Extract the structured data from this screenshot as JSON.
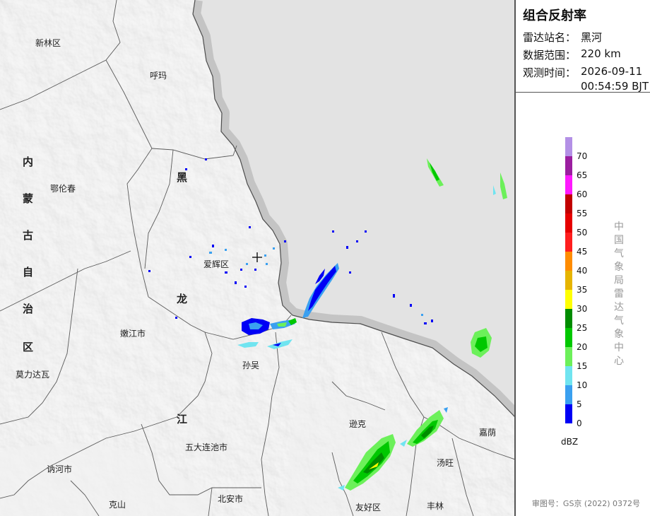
{
  "panel": {
    "title": "组合反射率",
    "station_label": "雷达站名：",
    "station_value": "黑河",
    "range_label": "数据范围：",
    "range_value": "220 km",
    "time_label": "观测时间：",
    "time_date": "2026-09-11",
    "time_clock": "00:54:59 BJT"
  },
  "legend": {
    "unit": "dBZ",
    "bins": [
      {
        "value": "70",
        "color": "#b390e6"
      },
      {
        "value": "65",
        "color": "#9b1ea0"
      },
      {
        "value": "60",
        "color": "#ff19ff"
      },
      {
        "value": "55",
        "color": "#c20000"
      },
      {
        "value": "50",
        "color": "#e60000"
      },
      {
        "value": "45",
        "color": "#ff1e1e"
      },
      {
        "value": "40",
        "color": "#ff8c00"
      },
      {
        "value": "35",
        "color": "#e6b400"
      },
      {
        "value": "30",
        "color": "#ffff00"
      },
      {
        "value": "25",
        "color": "#008c00"
      },
      {
        "value": "20",
        "color": "#00c800"
      },
      {
        "value": "15",
        "color": "#6cf05a"
      },
      {
        "value": "10",
        "color": "#70e4f0"
      },
      {
        "value": "5",
        "color": "#3aa0f0"
      },
      {
        "value": "0",
        "color": "#0000f5"
      }
    ]
  },
  "org_name": "中国气象局雷达气象中心",
  "copyright": "审图号：GS京 (2022) 0372号",
  "map": {
    "places": [
      "新林区",
      "呼玛",
      "鄂伦春",
      "爱辉区",
      "嫩江市",
      "孙吴",
      "莫力达瓦",
      "逊克",
      "嘉荫",
      "五大连池市",
      "讷河市",
      "汤旺",
      "北安市",
      "克山",
      "友好区",
      "丰林"
    ],
    "province_chars": [
      "内",
      "蒙",
      "古",
      "自",
      "治",
      "区",
      "黑",
      "龙",
      "江"
    ]
  }
}
